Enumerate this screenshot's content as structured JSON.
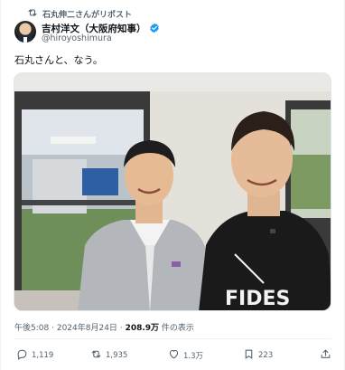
{
  "repost_banner": {
    "text": "石丸伸二さんがリポスト",
    "icon": "repost-icon"
  },
  "author": {
    "display_name": "吉村洋文（大阪府知事）",
    "handle": "@hiroyoshimura",
    "verified": true,
    "verified_color": "#1d9bf0"
  },
  "tweet": {
    "text": "石丸さんと、なう。"
  },
  "photo": {
    "shirt_text": "FIDES"
  },
  "meta": {
    "time": "午後5:08",
    "separator": "·",
    "date": "2024年8月24日",
    "views": "208.9万",
    "views_label": "件の表示"
  },
  "actions": {
    "reply_count": "1,119",
    "repost_count": "1,935",
    "like_count": "1.3万",
    "bookmark_count": "223"
  },
  "colors": {
    "text": "#0f1419",
    "secondary": "#536471",
    "border": "#eff3f4"
  }
}
